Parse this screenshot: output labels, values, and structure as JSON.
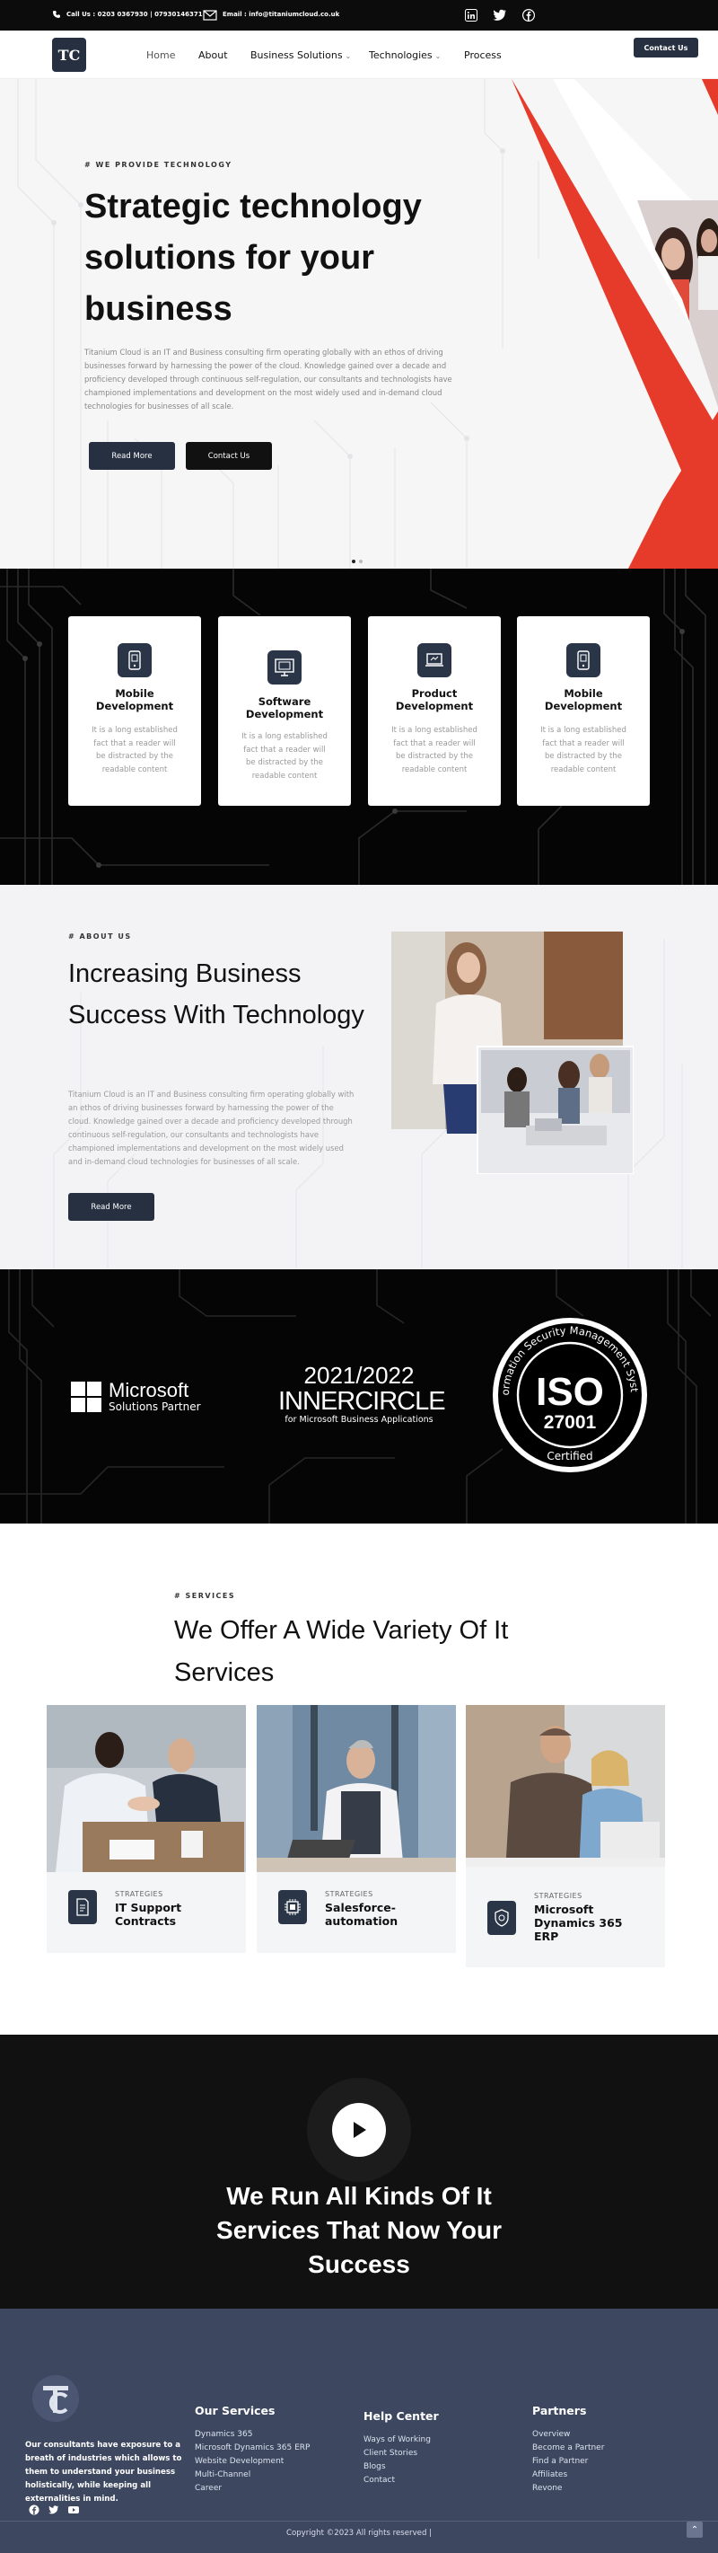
{
  "topbar": {
    "phone": "Call Us : 0203 0367930 | 07930146371",
    "email": "Email : info@titaniumcloud.co.uk",
    "social_icons": [
      "linkedin-icon",
      "twitter-icon",
      "facebook-icon"
    ]
  },
  "nav": {
    "logo": "TC",
    "items": [
      "Home",
      "About",
      "Business Solutions",
      "Technologies",
      "Process"
    ],
    "contact": "Contact Us"
  },
  "hero": {
    "kicker": "# WE PROVIDE TECHNOLOGY",
    "title": "Strategic technology solutions for your business",
    "text": "Titanium Cloud is an IT and Business consulting firm operating globally with an ethos of driving businesses forward by harnessing the power of the cloud. Knowledge gained over a decade and proficiency developed through continuous self-regulation, our consultants and technologists have championed implementations and development on the most widely used and in-demand cloud technologies for businesses of all scale.",
    "read_more": "Read More",
    "contact": "Contact Us",
    "accent": "#e63a2a"
  },
  "services_cards": [
    {
      "icon": "mobile-icon",
      "title": "Mobile Development",
      "text": "It is a long established fact that a reader will be distracted by the readable content"
    },
    {
      "icon": "monitor-icon",
      "title": "Software Development",
      "text": "It is a long established fact that a reader will be distracted by the readable content"
    },
    {
      "icon": "laptop-icon",
      "title": "Product Development",
      "text": "It is a long established fact that a reader will be distracted by the readable content"
    },
    {
      "icon": "mobile-icon",
      "title": "Mobile Development",
      "text": "It is a long established fact that a reader will be distracted by the readable content"
    }
  ],
  "about": {
    "kicker": "# ABOUT US",
    "title": "Increasing Business Success With Technology",
    "text": "Titanium Cloud is an IT and Business consulting firm operating globally with an ethos of driving businesses forward by harnessing the power of the cloud. Knowledge gained over a decade and proficiency developed through continuous self-regulation, our consultants and technologists have championed implementations and development on the most widely used and in-demand cloud technologies for businesses of all scale.",
    "read_more": "Read More"
  },
  "certs": {
    "ms_line1": "Microsoft",
    "ms_line2": "Solutions Partner",
    "inner_years": "2021/2022",
    "inner_name": "INNERCIRCLE",
    "inner_sub": "for Microsoft Business Applications",
    "iso_ring": "Information Security Management System",
    "iso_big": "ISO",
    "iso_num": "27001",
    "iso_cert": "Certified"
  },
  "offer": {
    "kicker": "# SERVICES",
    "title": "We Offer A Wide Variety Of It Services",
    "items": [
      {
        "icon": "document-icon",
        "kicker": "STRATEGIES",
        "title": "IT Support Contracts"
      },
      {
        "icon": "chip-icon",
        "kicker": "STRATEGIES",
        "title": "Salesforce-automation"
      },
      {
        "icon": "shield-icon",
        "kicker": "STRATEGIES",
        "title": "Microsoft Dynamics 365 ERP"
      }
    ]
  },
  "video": {
    "title": "We Run All Kinds Of It Services That Now Your Success"
  },
  "footer": {
    "about": "Our consultants have exposure to a breath of industries which allows to them to understand your business holistically, while keeping all externalities in mind.",
    "col1_title": "Our Services",
    "col1": [
      "Dynamics 365",
      "Microsoft Dynamics 365 ERP",
      "Website Development",
      "Multi-Channel",
      "Career"
    ],
    "col2_title": "Help Center",
    "col2": [
      "Ways of Working",
      "Client Stories",
      "Blogs",
      "Contact"
    ],
    "col3_title": "Partners",
    "col3": [
      "Overview",
      "Become a Partner",
      "Find a Partner",
      "Affiliates",
      "Revone"
    ],
    "copyright": "Copyright ©2023 All rights reserved |"
  }
}
